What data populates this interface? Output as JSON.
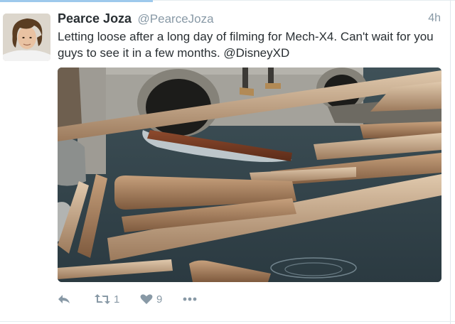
{
  "tweet": {
    "author_name": "Pearce Joza",
    "author_handle": "@PearceJoza",
    "timestamp": "4h",
    "text": "Letting loose after a long day of filming for Mech-X4. Can't wait for you guys to see it in a few months. @DisneyXD",
    "retweet_count": "1",
    "like_count": "9"
  },
  "icons": {
    "reply": "reply-icon",
    "retweet": "retweet-icon",
    "like": "heart-icon",
    "more": "more-icon"
  },
  "colors": {
    "name": "#292f33",
    "meta": "#8899a6",
    "accent": "#9ec9ec"
  }
}
